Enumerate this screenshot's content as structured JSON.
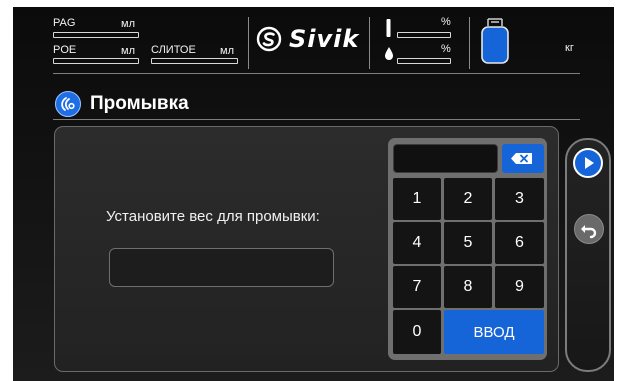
{
  "header": {
    "pag_label": "PAG",
    "pag_unit": "мл",
    "poe_label": "POE",
    "poe_unit": "мл",
    "drain_label": "СЛИТОЕ",
    "drain_unit": "мл",
    "brand": "Sivik",
    "vacuum_unit": "%",
    "oil_unit": "%",
    "tank_unit": "кг"
  },
  "page": {
    "title": "Промывка",
    "icon": "flush-icon"
  },
  "form": {
    "prompt": "Установите вес для промывки:",
    "weight_value": ""
  },
  "keypad": {
    "display_value": "",
    "keys": [
      "1",
      "2",
      "3",
      "4",
      "5",
      "6",
      "7",
      "8",
      "9",
      "0"
    ],
    "enter_label": "ВВОД",
    "backspace_icon": "backspace-icon"
  },
  "side_nav": {
    "next_icon": "play-icon",
    "back_icon": "return-icon"
  },
  "colors": {
    "accent": "#1565d8",
    "background": "#141414",
    "panel": "#2a2a2a"
  }
}
